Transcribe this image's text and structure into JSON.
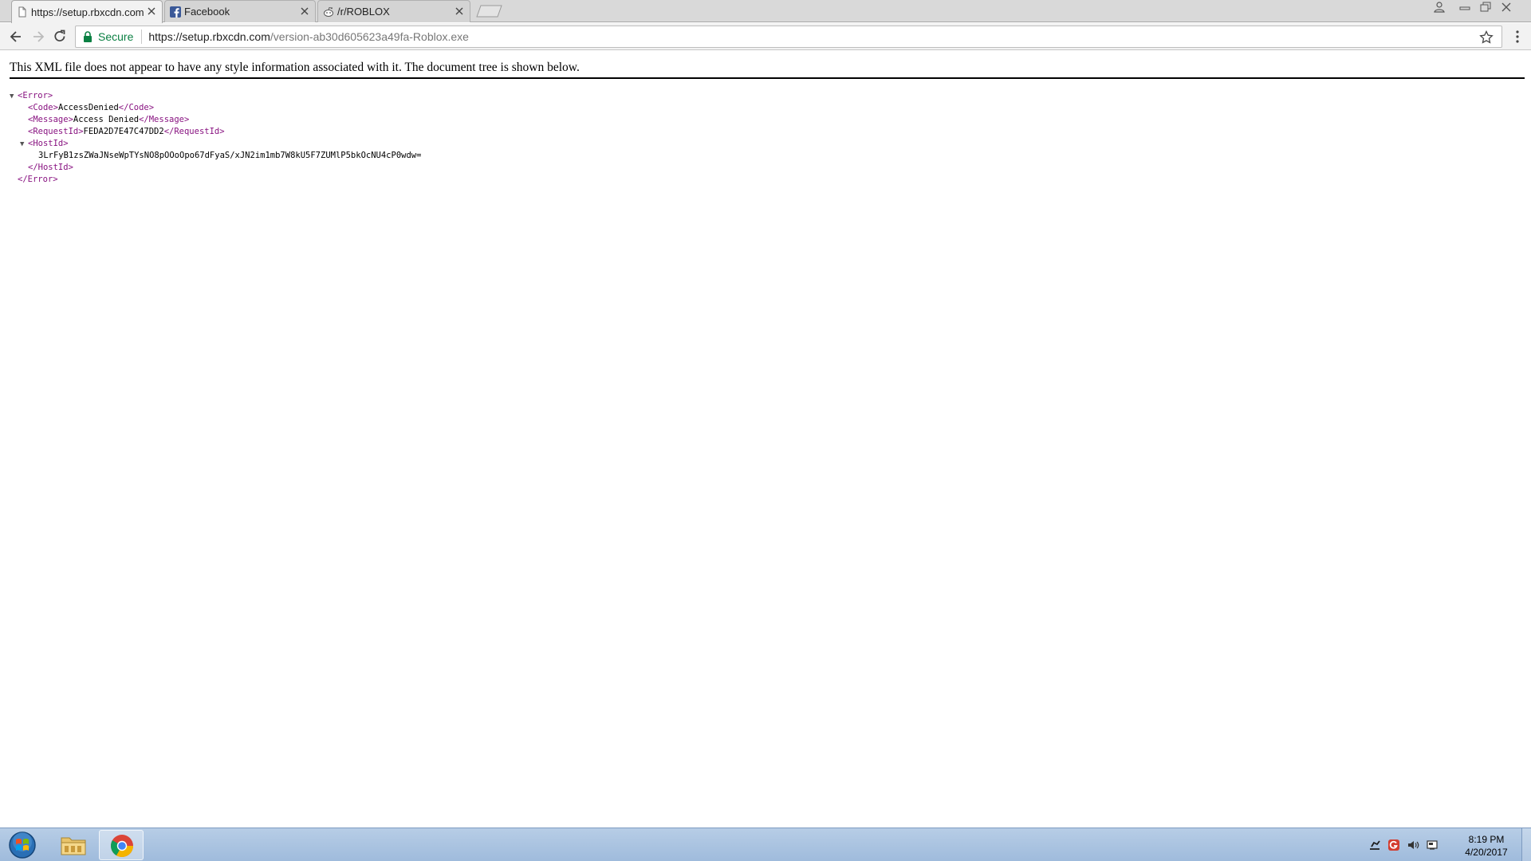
{
  "browser": {
    "tabs": [
      {
        "title": "https://setup.rbxcdn.com",
        "icon": "document-icon",
        "active": true
      },
      {
        "title": "Facebook",
        "icon": "facebook-icon",
        "active": false
      },
      {
        "title": "/r/ROBLOX",
        "icon": "reddit-icon",
        "active": false
      }
    ],
    "address": {
      "security_label": "Secure",
      "url_host": "https://setup.rbxcdn.com",
      "url_path": "/version-ab30d605623a49fa-Roblox.exe"
    },
    "colors": {
      "secure_green": "#0b8043",
      "xml_tag": "#881280"
    }
  },
  "page": {
    "info": "This XML file does not appear to have any style information associated with it. The document tree is shown below.",
    "xml": {
      "error_open": "<Error>",
      "code_open": "<Code>",
      "code_value": "AccessDenied",
      "code_close": "</Code>",
      "message_open": "<Message>",
      "message_value": "Access Denied",
      "message_close": "</Message>",
      "requestid_open": "<RequestId>",
      "requestid_value": "FEDA2D7E47C47DD2",
      "requestid_close": "</RequestId>",
      "hostid_open": "<HostId>",
      "hostid_value": "3LrFyB1zsZWaJNseWpTYsNO8pOOoOpo67dFyaS/xJN2im1mb7W8kU5F7ZUMlP5bkOcNU4cP0wdw=",
      "hostid_close": "</HostId>",
      "error_close": "</Error>"
    }
  },
  "taskbar": {
    "pinned": [
      "windows-start-orb",
      "file-explorer-icon",
      "chrome-icon"
    ],
    "tray_icons": [
      "network-icon",
      "app-tray-icon",
      "volume-icon",
      "action-center-icon"
    ],
    "clock_time": "8:19 PM",
    "clock_date": "4/20/2017"
  }
}
